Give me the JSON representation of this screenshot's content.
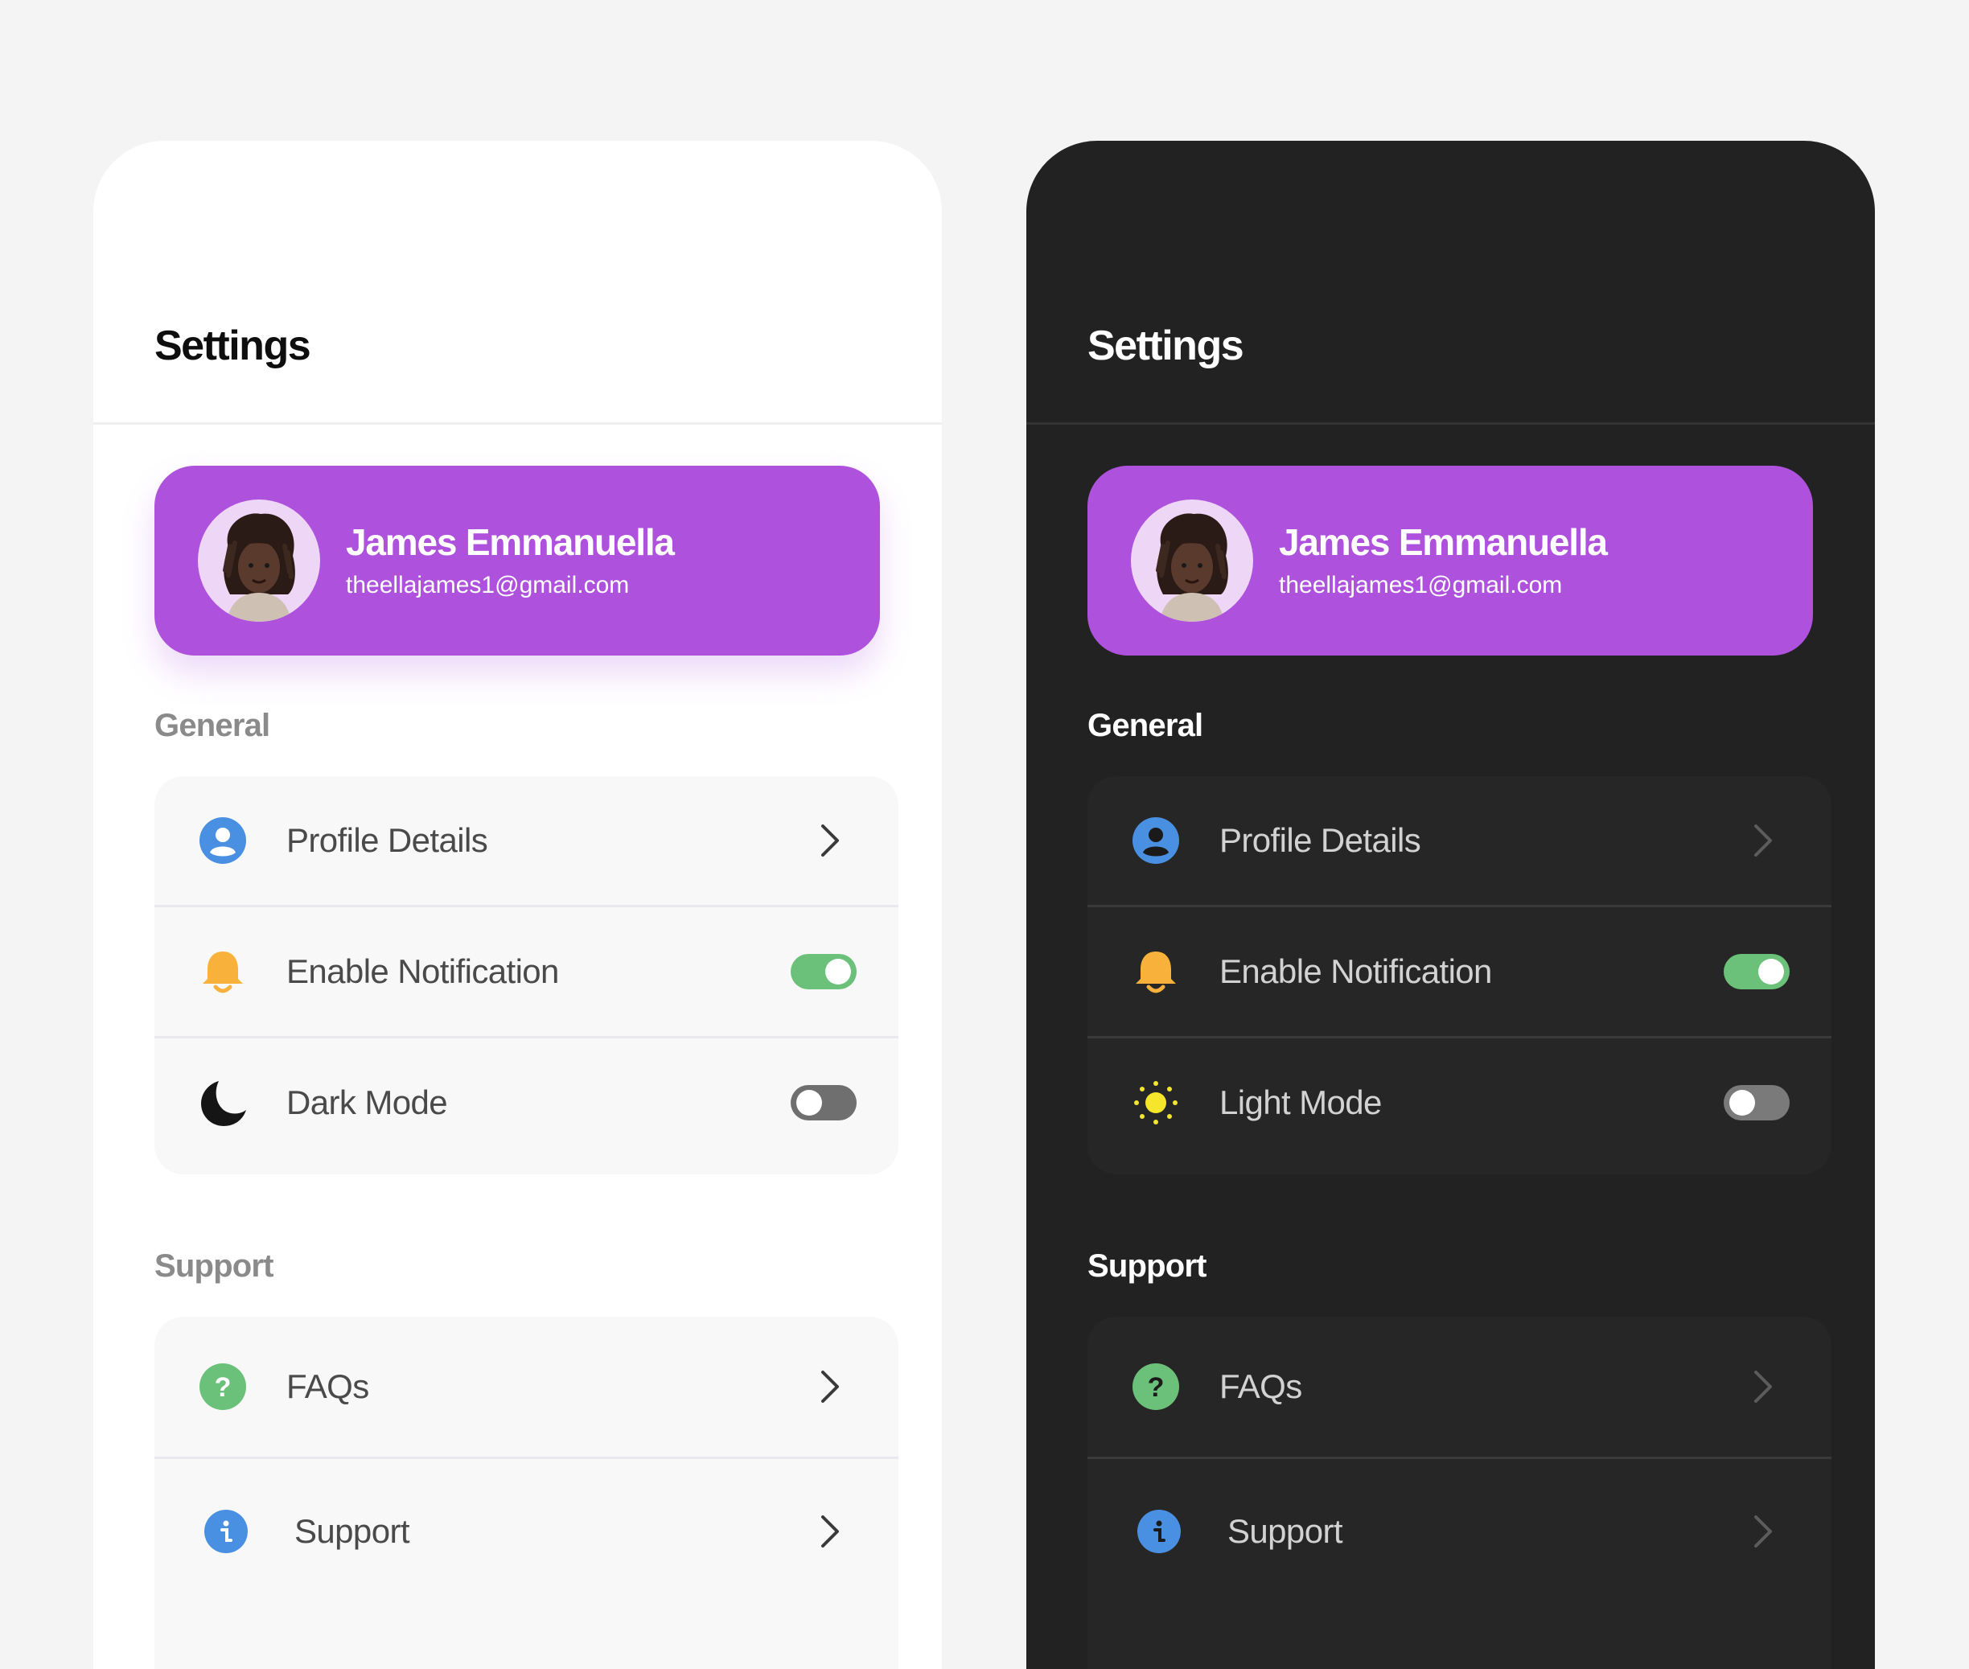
{
  "colors": {
    "accent_purple": "#ae51dd",
    "toggle_on": "#6bc07a",
    "toggle_off": "#7a7a7a",
    "profile_icon_blue": "#4a90e2",
    "bell_orange": "#f8b13b",
    "faq_green": "#6bc07a",
    "support_blue": "#4a90e2",
    "sun_yellow": "#f5e52b",
    "light_bg": "#ffffff",
    "dark_bg": "#222222"
  },
  "light_panel": {
    "title": "Settings",
    "profile": {
      "name": "James Emmanuella",
      "email": "theellajames1@gmail.com"
    },
    "general_title": "General",
    "general_items": [
      {
        "label": "Profile Details",
        "icon": "user-circle-icon",
        "control": "chevron"
      },
      {
        "label": "Enable Notification",
        "icon": "bell-icon",
        "control": "toggle",
        "on": true
      },
      {
        "label": "Dark Mode",
        "icon": "moon-icon",
        "control": "toggle",
        "on": false
      }
    ],
    "support_title": "Support",
    "support_items": [
      {
        "label": "FAQs",
        "icon": "question-icon",
        "control": "chevron"
      },
      {
        "label": "Support",
        "icon": "info-icon",
        "control": "chevron"
      }
    ]
  },
  "dark_panel": {
    "title": "Settings",
    "profile": {
      "name": "James Emmanuella",
      "email": "theellajames1@gmail.com"
    },
    "general_title": "General",
    "general_items": [
      {
        "label": "Profile Details",
        "icon": "user-circle-icon",
        "control": "chevron"
      },
      {
        "label": "Enable Notification",
        "icon": "bell-icon",
        "control": "toggle",
        "on": true
      },
      {
        "label": "Light Mode",
        "icon": "sun-icon",
        "control": "toggle",
        "on": false
      }
    ],
    "support_title": "Support",
    "support_items": [
      {
        "label": "FAQs",
        "icon": "question-icon",
        "control": "chevron"
      },
      {
        "label": "Support",
        "icon": "info-icon",
        "control": "chevron"
      }
    ]
  }
}
